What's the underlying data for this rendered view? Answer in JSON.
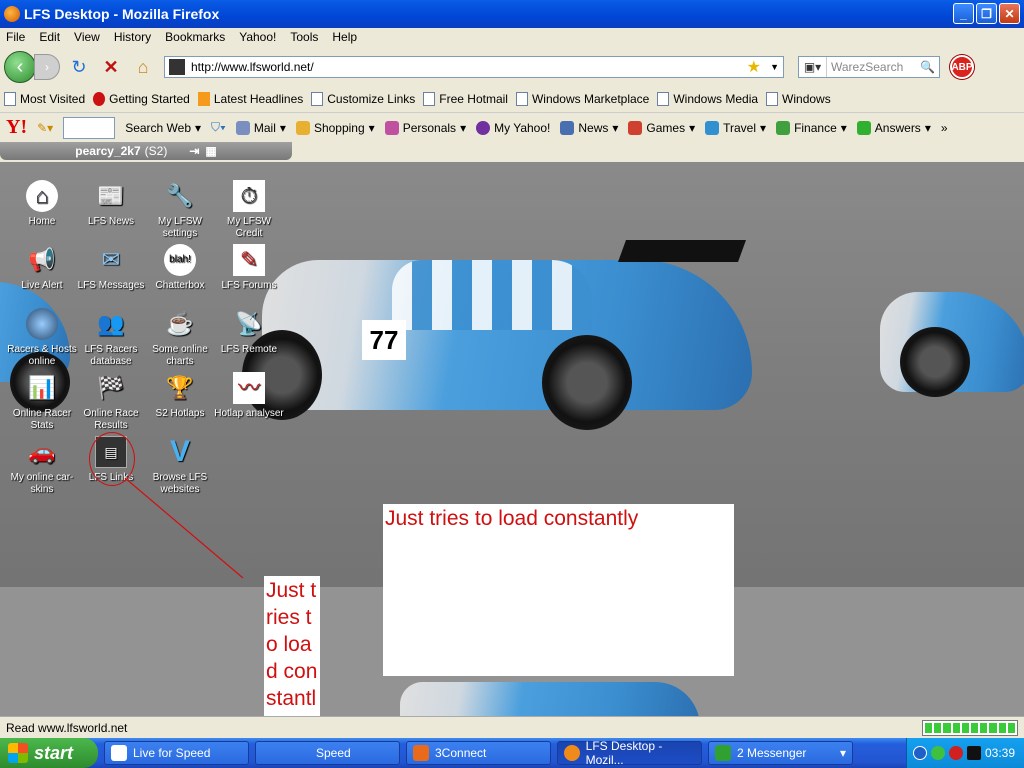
{
  "window": {
    "title": "LFS Desktop - Mozilla Firefox"
  },
  "menu": [
    "File",
    "Edit",
    "View",
    "History",
    "Bookmarks",
    "Yahoo!",
    "Tools",
    "Help"
  ],
  "nav": {
    "url": "http://www.lfsworld.net/",
    "search_placeholder": "WarezSearch",
    "abp": "ABP"
  },
  "bookmarks": [
    "Most Visited",
    "Getting Started",
    "Latest Headlines",
    "Customize Links",
    "Free Hotmail",
    "Windows Marketplace",
    "Windows Media",
    "Windows"
  ],
  "yahoo": {
    "logo": "Y!",
    "search_web": "Search Web",
    "items": [
      "Mail",
      "Shopping",
      "Personals",
      "My Yahoo!",
      "News",
      "Games",
      "Travel",
      "Finance",
      "Answers"
    ],
    "more": "»"
  },
  "user": {
    "name": "pearcy_2k7",
    "license": "(S2)"
  },
  "car": {
    "number": "77"
  },
  "desktop_icons": [
    {
      "label": "Home",
      "icon": "home-icon"
    },
    {
      "label": "LFS News",
      "icon": "news-icon"
    },
    {
      "label": "My LFSW settings",
      "icon": "settings-icon"
    },
    {
      "label": "My LFSW Credit",
      "icon": "credit-icon"
    },
    {
      "label": "Live Alert",
      "icon": "alert-icon"
    },
    {
      "label": "LFS Messages",
      "icon": "messages-icon"
    },
    {
      "label": "Chatterbox",
      "icon": "chat-icon"
    },
    {
      "label": "LFS Forums",
      "icon": "forums-icon"
    },
    {
      "label": "Racers & Hosts online",
      "icon": "globe-icon"
    },
    {
      "label": "LFS Racers database",
      "icon": "racers-icon"
    },
    {
      "label": "Some online charts",
      "icon": "cup-icon"
    },
    {
      "label": "LFS Remote",
      "icon": "remote-icon"
    },
    {
      "label": "Online Racer Stats",
      "icon": "stats-icon"
    },
    {
      "label": "Online Race Results",
      "icon": "flag-icon"
    },
    {
      "label": "S2 Hotlaps",
      "icon": "trophy-icon"
    },
    {
      "label": "Hotlap analyser",
      "icon": "analyser-icon"
    },
    {
      "label": "My online car-skins",
      "icon": "skins-icon"
    },
    {
      "label": "LFS Links",
      "icon": "links-icon"
    },
    {
      "label": "Browse LFS websites",
      "icon": "browse-icon"
    }
  ],
  "annotations": {
    "box": "Just tries to load constantly",
    "narrow": "Just tries to load constantl"
  },
  "status": {
    "text": "Read www.lfsworld.net"
  },
  "taskbar": {
    "start": "start",
    "tasks": [
      "Live for Speed",
      "Speed",
      "3Connect",
      "LFS Desktop - Mozil...",
      "2 Messenger"
    ],
    "clock": "03:39"
  }
}
